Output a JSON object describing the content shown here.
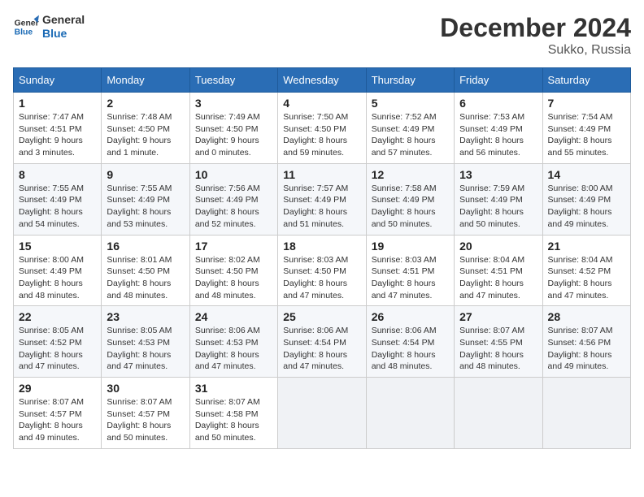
{
  "header": {
    "logo_line1": "General",
    "logo_line2": "Blue",
    "title": "December 2024",
    "subtitle": "Sukko, Russia"
  },
  "columns": [
    "Sunday",
    "Monday",
    "Tuesday",
    "Wednesday",
    "Thursday",
    "Friday",
    "Saturday"
  ],
  "weeks": [
    [
      {
        "day": "1",
        "detail": "Sunrise: 7:47 AM\nSunset: 4:51 PM\nDaylight: 9 hours\nand 3 minutes."
      },
      {
        "day": "2",
        "detail": "Sunrise: 7:48 AM\nSunset: 4:50 PM\nDaylight: 9 hours\nand 1 minute."
      },
      {
        "day": "3",
        "detail": "Sunrise: 7:49 AM\nSunset: 4:50 PM\nDaylight: 9 hours\nand 0 minutes."
      },
      {
        "day": "4",
        "detail": "Sunrise: 7:50 AM\nSunset: 4:50 PM\nDaylight: 8 hours\nand 59 minutes."
      },
      {
        "day": "5",
        "detail": "Sunrise: 7:52 AM\nSunset: 4:49 PM\nDaylight: 8 hours\nand 57 minutes."
      },
      {
        "day": "6",
        "detail": "Sunrise: 7:53 AM\nSunset: 4:49 PM\nDaylight: 8 hours\nand 56 minutes."
      },
      {
        "day": "7",
        "detail": "Sunrise: 7:54 AM\nSunset: 4:49 PM\nDaylight: 8 hours\nand 55 minutes."
      }
    ],
    [
      {
        "day": "8",
        "detail": "Sunrise: 7:55 AM\nSunset: 4:49 PM\nDaylight: 8 hours\nand 54 minutes."
      },
      {
        "day": "9",
        "detail": "Sunrise: 7:55 AM\nSunset: 4:49 PM\nDaylight: 8 hours\nand 53 minutes."
      },
      {
        "day": "10",
        "detail": "Sunrise: 7:56 AM\nSunset: 4:49 PM\nDaylight: 8 hours\nand 52 minutes."
      },
      {
        "day": "11",
        "detail": "Sunrise: 7:57 AM\nSunset: 4:49 PM\nDaylight: 8 hours\nand 51 minutes."
      },
      {
        "day": "12",
        "detail": "Sunrise: 7:58 AM\nSunset: 4:49 PM\nDaylight: 8 hours\nand 50 minutes."
      },
      {
        "day": "13",
        "detail": "Sunrise: 7:59 AM\nSunset: 4:49 PM\nDaylight: 8 hours\nand 50 minutes."
      },
      {
        "day": "14",
        "detail": "Sunrise: 8:00 AM\nSunset: 4:49 PM\nDaylight: 8 hours\nand 49 minutes."
      }
    ],
    [
      {
        "day": "15",
        "detail": "Sunrise: 8:00 AM\nSunset: 4:49 PM\nDaylight: 8 hours\nand 48 minutes."
      },
      {
        "day": "16",
        "detail": "Sunrise: 8:01 AM\nSunset: 4:50 PM\nDaylight: 8 hours\nand 48 minutes."
      },
      {
        "day": "17",
        "detail": "Sunrise: 8:02 AM\nSunset: 4:50 PM\nDaylight: 8 hours\nand 48 minutes."
      },
      {
        "day": "18",
        "detail": "Sunrise: 8:03 AM\nSunset: 4:50 PM\nDaylight: 8 hours\nand 47 minutes."
      },
      {
        "day": "19",
        "detail": "Sunrise: 8:03 AM\nSunset: 4:51 PM\nDaylight: 8 hours\nand 47 minutes."
      },
      {
        "day": "20",
        "detail": "Sunrise: 8:04 AM\nSunset: 4:51 PM\nDaylight: 8 hours\nand 47 minutes."
      },
      {
        "day": "21",
        "detail": "Sunrise: 8:04 AM\nSunset: 4:52 PM\nDaylight: 8 hours\nand 47 minutes."
      }
    ],
    [
      {
        "day": "22",
        "detail": "Sunrise: 8:05 AM\nSunset: 4:52 PM\nDaylight: 8 hours\nand 47 minutes."
      },
      {
        "day": "23",
        "detail": "Sunrise: 8:05 AM\nSunset: 4:53 PM\nDaylight: 8 hours\nand 47 minutes."
      },
      {
        "day": "24",
        "detail": "Sunrise: 8:06 AM\nSunset: 4:53 PM\nDaylight: 8 hours\nand 47 minutes."
      },
      {
        "day": "25",
        "detail": "Sunrise: 8:06 AM\nSunset: 4:54 PM\nDaylight: 8 hours\nand 47 minutes."
      },
      {
        "day": "26",
        "detail": "Sunrise: 8:06 AM\nSunset: 4:54 PM\nDaylight: 8 hours\nand 48 minutes."
      },
      {
        "day": "27",
        "detail": "Sunrise: 8:07 AM\nSunset: 4:55 PM\nDaylight: 8 hours\nand 48 minutes."
      },
      {
        "day": "28",
        "detail": "Sunrise: 8:07 AM\nSunset: 4:56 PM\nDaylight: 8 hours\nand 49 minutes."
      }
    ],
    [
      {
        "day": "29",
        "detail": "Sunrise: 8:07 AM\nSunset: 4:57 PM\nDaylight: 8 hours\nand 49 minutes."
      },
      {
        "day": "30",
        "detail": "Sunrise: 8:07 AM\nSunset: 4:57 PM\nDaylight: 8 hours\nand 50 minutes."
      },
      {
        "day": "31",
        "detail": "Sunrise: 8:07 AM\nSunset: 4:58 PM\nDaylight: 8 hours\nand 50 minutes."
      },
      null,
      null,
      null,
      null
    ]
  ]
}
